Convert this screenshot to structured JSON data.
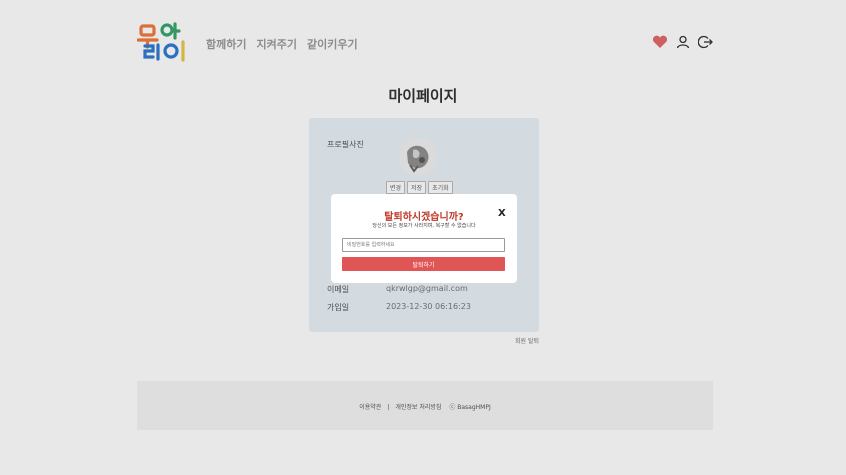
{
  "header": {
    "logo": {
      "text": "우리아이",
      "colors": [
        "#f07b3f",
        "#3aa76d",
        "#2f7bd6",
        "#e8c74a"
      ]
    },
    "nav": [
      "함께하기",
      "지켜주기",
      "같이키우기"
    ],
    "icons": [
      "heart-icon",
      "user-icon",
      "logout-icon"
    ],
    "heart_color": "#e46a6a"
  },
  "page_title": "마이페이지",
  "profile": {
    "photo_label": "프로필사진",
    "photo_buttons": [
      "변경",
      "저장",
      "초기화"
    ],
    "email_label": "이메일",
    "email_value": "qkrwlgp@gmail.com",
    "joined_label": "가입일",
    "joined_value": "2023-12-30 06:16:23",
    "card_color": "#e8f1f8"
  },
  "withdraw_link": "회원 탈퇴",
  "footer": {
    "terms": "이용약관",
    "separator": "|",
    "privacy": "개인정보 처리방침",
    "copyright": "ⓒ BasagHMPJ"
  },
  "modal": {
    "title": "탈퇴하시겠습니까?",
    "close": "X",
    "description": "당신의 모든 정보가 사라지며, 복구할 수 없습니다",
    "password_placeholder": "비밀번호를 입력하세요",
    "confirm_label": "탈퇴하기",
    "title_color": "#c0392b",
    "button_color": "#e05555"
  }
}
